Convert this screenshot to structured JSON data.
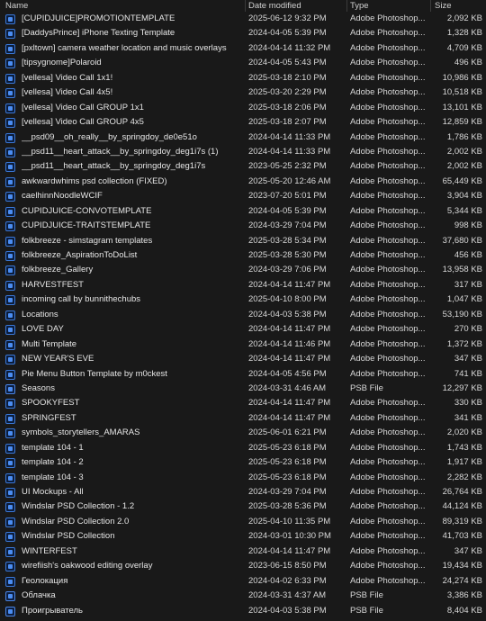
{
  "header": {
    "name": "Name",
    "date_modified": "Date modified",
    "type": "Type",
    "size": "Size"
  },
  "rows": [
    {
      "name": "[CUPIDJUICE]PROMOTIONTEMPLATE",
      "date": "2025-06-12 9:32 PM",
      "type": "Adobe Photoshop...",
      "size": "2,092 KB",
      "icon": "photoshop-file-icon"
    },
    {
      "name": "[DaddysPrince] iPhone Texting Template",
      "date": "2024-04-05 5:39 PM",
      "type": "Adobe Photoshop...",
      "size": "1,328 KB",
      "icon": "photoshop-file-icon"
    },
    {
      "name": "[pxltown] camera weather location and music overlays",
      "date": "2024-04-14 11:32 PM",
      "type": "Adobe Photoshop...",
      "size": "4,709 KB",
      "icon": "photoshop-file-icon"
    },
    {
      "name": "[tipsygnome]Polaroid",
      "date": "2024-04-05 5:43 PM",
      "type": "Adobe Photoshop...",
      "size": "496 KB",
      "icon": "photoshop-file-icon"
    },
    {
      "name": "[vellesa] Video Call 1x1!",
      "date": "2025-03-18 2:10 PM",
      "type": "Adobe Photoshop...",
      "size": "10,986 KB",
      "icon": "photoshop-file-icon"
    },
    {
      "name": "[vellesa] Video Call 4x5!",
      "date": "2025-03-20 2:29 PM",
      "type": "Adobe Photoshop...",
      "size": "10,518 KB",
      "icon": "photoshop-file-icon"
    },
    {
      "name": "[vellesa] Video Call GROUP 1x1",
      "date": "2025-03-18 2:06 PM",
      "type": "Adobe Photoshop...",
      "size": "13,101 KB",
      "icon": "photoshop-file-icon"
    },
    {
      "name": "[vellesa] Video Call GROUP 4x5",
      "date": "2025-03-18 2:07 PM",
      "type": "Adobe Photoshop...",
      "size": "12,859 KB",
      "icon": "photoshop-file-icon"
    },
    {
      "name": "__psd09__oh_really__by_springdoy_de0e51o",
      "date": "2024-04-14 11:33 PM",
      "type": "Adobe Photoshop...",
      "size": "1,786 KB",
      "icon": "photoshop-file-icon"
    },
    {
      "name": "__psd11__heart_attack__by_springdoy_deg1i7s (1)",
      "date": "2024-04-14 11:33 PM",
      "type": "Adobe Photoshop...",
      "size": "2,002 KB",
      "icon": "photoshop-file-icon"
    },
    {
      "name": "__psd11__heart_attack__by_springdoy_deg1i7s",
      "date": "2023-05-25 2:32 PM",
      "type": "Adobe Photoshop...",
      "size": "2,002 KB",
      "icon": "photoshop-file-icon"
    },
    {
      "name": "awkwardwhims psd collection (FIXED)",
      "date": "2025-05-20 12:46 AM",
      "type": "Adobe Photoshop...",
      "size": "65,449 KB",
      "icon": "photoshop-file-icon"
    },
    {
      "name": "caelhinnNoodleWCIF",
      "date": "2023-07-20 5:01 PM",
      "type": "Adobe Photoshop...",
      "size": "3,904 KB",
      "icon": "photoshop-file-icon"
    },
    {
      "name": "CUPIDJUICE-CONVOTEMPLATE",
      "date": "2024-04-05 5:39 PM",
      "type": "Adobe Photoshop...",
      "size": "5,344 KB",
      "icon": "photoshop-file-icon"
    },
    {
      "name": "CUPIDJUICE-TRAITSTEMPLATE",
      "date": "2024-03-29 7:04 PM",
      "type": "Adobe Photoshop...",
      "size": "998 KB",
      "icon": "photoshop-file-icon"
    },
    {
      "name": "folkbreeze - simstagram templates",
      "date": "2025-03-28 5:34 PM",
      "type": "Adobe Photoshop...",
      "size": "37,680 KB",
      "icon": "photoshop-file-icon"
    },
    {
      "name": "folkbreeze_AspirationToDoList",
      "date": "2025-03-28 5:30 PM",
      "type": "Adobe Photoshop...",
      "size": "456 KB",
      "icon": "photoshop-file-icon"
    },
    {
      "name": "folkbreeze_Gallery",
      "date": "2024-03-29 7:06 PM",
      "type": "Adobe Photoshop...",
      "size": "13,958 KB",
      "icon": "photoshop-file-icon"
    },
    {
      "name": "HARVESTFEST",
      "date": "2024-04-14 11:47 PM",
      "type": "Adobe Photoshop...",
      "size": "317 KB",
      "icon": "photoshop-file-icon"
    },
    {
      "name": "incoming call by bunnithechubs",
      "date": "2025-04-10 8:00 PM",
      "type": "Adobe Photoshop...",
      "size": "1,047 KB",
      "icon": "photoshop-file-icon"
    },
    {
      "name": "Locations",
      "date": "2024-04-03 5:38 PM",
      "type": "Adobe Photoshop...",
      "size": "53,190 KB",
      "icon": "photoshop-file-icon"
    },
    {
      "name": "LOVE DAY",
      "date": "2024-04-14 11:47 PM",
      "type": "Adobe Photoshop...",
      "size": "270 KB",
      "icon": "photoshop-file-icon"
    },
    {
      "name": "Multi Template",
      "date": "2024-04-14 11:46 PM",
      "type": "Adobe Photoshop...",
      "size": "1,372 KB",
      "icon": "photoshop-file-icon"
    },
    {
      "name": "NEW YEAR'S EVE",
      "date": "2024-04-14 11:47 PM",
      "type": "Adobe Photoshop...",
      "size": "347 KB",
      "icon": "photoshop-file-icon"
    },
    {
      "name": "Pie Menu Button Template by m0ckest",
      "date": "2024-04-05 4:56 PM",
      "type": "Adobe Photoshop...",
      "size": "741 KB",
      "icon": "photoshop-file-icon"
    },
    {
      "name": "Seasons",
      "date": "2024-03-31 4:46 AM",
      "type": "PSB File",
      "size": "12,297 KB",
      "icon": "psb-file-icon"
    },
    {
      "name": "SPOOKYFEST",
      "date": "2024-04-14 11:47 PM",
      "type": "Adobe Photoshop...",
      "size": "330 KB",
      "icon": "photoshop-file-icon"
    },
    {
      "name": "SPRINGFEST",
      "date": "2024-04-14 11:47 PM",
      "type": "Adobe Photoshop...",
      "size": "341 KB",
      "icon": "photoshop-file-icon"
    },
    {
      "name": "symbols_storytellers_AMARAS",
      "date": "2025-06-01 6:21 PM",
      "type": "Adobe Photoshop...",
      "size": "2,020 KB",
      "icon": "photoshop-file-icon"
    },
    {
      "name": "template 104 - 1",
      "date": "2025-05-23 6:18 PM",
      "type": "Adobe Photoshop...",
      "size": "1,743 KB",
      "icon": "photoshop-file-icon"
    },
    {
      "name": "template 104 - 2",
      "date": "2025-05-23 6:18 PM",
      "type": "Adobe Photoshop...",
      "size": "1,917 KB",
      "icon": "photoshop-file-icon"
    },
    {
      "name": "template 104 - 3",
      "date": "2025-05-23 6:18 PM",
      "type": "Adobe Photoshop...",
      "size": "2,282 KB",
      "icon": "photoshop-file-icon"
    },
    {
      "name": "UI Mockups - All",
      "date": "2024-03-29 7:04 PM",
      "type": "Adobe Photoshop...",
      "size": "26,764 KB",
      "icon": "photoshop-file-icon"
    },
    {
      "name": "Windslar PSD Collection - 1.2",
      "date": "2025-03-28 5:36 PM",
      "type": "Adobe Photoshop...",
      "size": "44,124 KB",
      "icon": "photoshop-file-icon"
    },
    {
      "name": "Windslar PSD Collection 2.0",
      "date": "2025-04-10 11:35 PM",
      "type": "Adobe Photoshop...",
      "size": "89,319 KB",
      "icon": "photoshop-file-icon"
    },
    {
      "name": "Windslar PSD Collection",
      "date": "2024-03-01 10:30 PM",
      "type": "Adobe Photoshop...",
      "size": "41,703 KB",
      "icon": "photoshop-file-icon"
    },
    {
      "name": "WINTERFEST",
      "date": "2024-04-14 11:47 PM",
      "type": "Adobe Photoshop...",
      "size": "347 KB",
      "icon": "photoshop-file-icon"
    },
    {
      "name": "wirefiish's oakwood editing overlay",
      "date": "2023-06-15 8:50 PM",
      "type": "Adobe Photoshop...",
      "size": "19,434 KB",
      "icon": "photoshop-file-icon"
    },
    {
      "name": "Геолокация",
      "date": "2024-04-02 6:33 PM",
      "type": "Adobe Photoshop...",
      "size": "24,274 KB",
      "icon": "photoshop-file-icon"
    },
    {
      "name": "Облачка",
      "date": "2024-03-31 4:37 AM",
      "type": "PSB File",
      "size": "3,386 KB",
      "icon": "psb-file-icon"
    },
    {
      "name": "Проигрыватель",
      "date": "2024-04-03 5:38 PM",
      "type": "PSB File",
      "size": "8,404 KB",
      "icon": "psb-file-icon"
    }
  ]
}
